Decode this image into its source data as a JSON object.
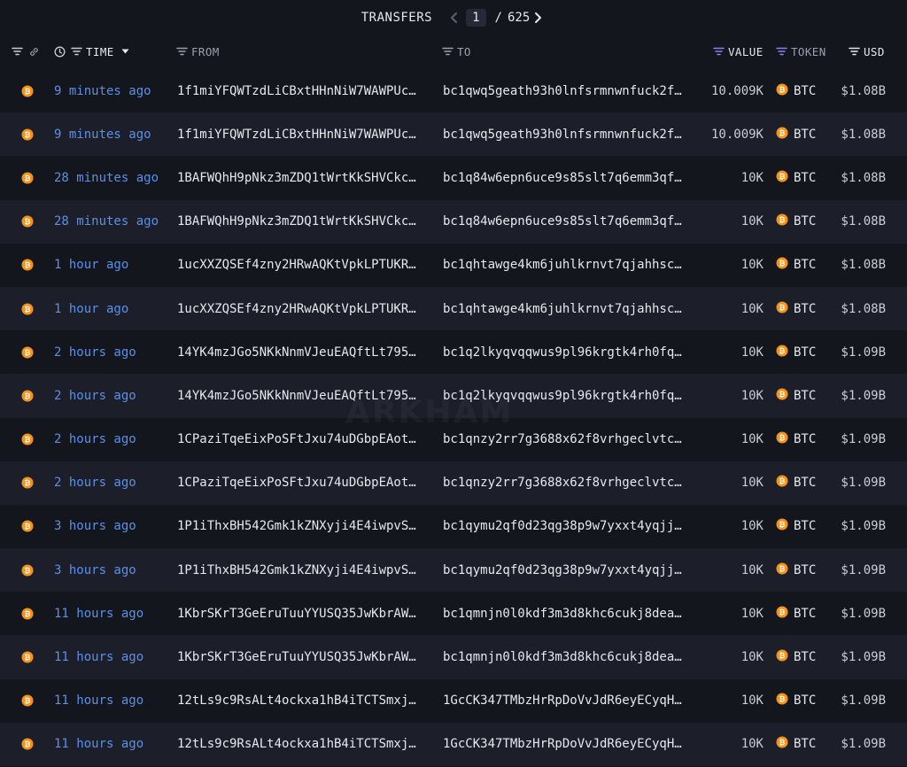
{
  "header": {
    "title": "TRANSFERS",
    "current_page": "1",
    "separator": "/",
    "total_pages": "625"
  },
  "columns": {
    "time": "TIME",
    "from": "FROM",
    "to": "TO",
    "value": "VALUE",
    "token": "TOKEN",
    "usd": "USD"
  },
  "watermark": "ARKHAM",
  "colors": {
    "background": "#14161e",
    "row_alt": "#1c1f2a",
    "time_link": "#5c8fe6",
    "btc": "#f7931a",
    "active_filter": "#8f7df2"
  },
  "rows": [
    {
      "time": "9 minutes ago",
      "from": "1f1miYFQWTzdLiCBxtHHnNiW7WAWPUc…",
      "to": "bc1qwq5geath93h0lnfsrmnwnfuck2f…",
      "value": "10.009K",
      "token": "BTC",
      "usd": "$1.08B"
    },
    {
      "time": "9 minutes ago",
      "from": "1f1miYFQWTzdLiCBxtHHnNiW7WAWPUc…",
      "to": "bc1qwq5geath93h0lnfsrmnwnfuck2f…",
      "value": "10.009K",
      "token": "BTC",
      "usd": "$1.08B"
    },
    {
      "time": "28 minutes ago",
      "from": "1BAFWQhH9pNkz3mZDQ1tWrtKkSHVCkc…",
      "to": "bc1q84w6epn6uce9s85slt7q6emm3qf…",
      "value": "10K",
      "token": "BTC",
      "usd": "$1.08B"
    },
    {
      "time": "28 minutes ago",
      "from": "1BAFWQhH9pNkz3mZDQ1tWrtKkSHVCkc…",
      "to": "bc1q84w6epn6uce9s85slt7q6emm3qf…",
      "value": "10K",
      "token": "BTC",
      "usd": "$1.08B"
    },
    {
      "time": "1 hour ago",
      "from": "1ucXXZQSEf4zny2HRwAQKtVpkLPTUKR…",
      "to": "bc1qhtawge4km6juhlkrnvt7qjahhsc…",
      "value": "10K",
      "token": "BTC",
      "usd": "$1.08B"
    },
    {
      "time": "1 hour ago",
      "from": "1ucXXZQSEf4zny2HRwAQKtVpkLPTUKR…",
      "to": "bc1qhtawge4km6juhlkrnvt7qjahhsc…",
      "value": "10K",
      "token": "BTC",
      "usd": "$1.08B"
    },
    {
      "time": "2 hours ago",
      "from": "14YK4mzJGo5NKkNnmVJeuEAQftLt795…",
      "to": "bc1q2lkyqvqqwus9pl96krgtk4rh0fq…",
      "value": "10K",
      "token": "BTC",
      "usd": "$1.09B"
    },
    {
      "time": "2 hours ago",
      "from": "14YK4mzJGo5NKkNnmVJeuEAQftLt795…",
      "to": "bc1q2lkyqvqqwus9pl96krgtk4rh0fq…",
      "value": "10K",
      "token": "BTC",
      "usd": "$1.09B"
    },
    {
      "time": "2 hours ago",
      "from": "1CPaziTqeEixPoSFtJxu74uDGbpEAot…",
      "to": "bc1qnzy2rr7g3688x62f8vrhgeclvtc…",
      "value": "10K",
      "token": "BTC",
      "usd": "$1.09B"
    },
    {
      "time": "2 hours ago",
      "from": "1CPaziTqeEixPoSFtJxu74uDGbpEAot…",
      "to": "bc1qnzy2rr7g3688x62f8vrhgeclvtc…",
      "value": "10K",
      "token": "BTC",
      "usd": "$1.09B"
    },
    {
      "time": "3 hours ago",
      "from": "1P1iThxBH542Gmk1kZNXyji4E4iwpvS…",
      "to": "bc1qymu2qf0d23qg38p9w7yxxt4yqjj…",
      "value": "10K",
      "token": "BTC",
      "usd": "$1.09B"
    },
    {
      "time": "3 hours ago",
      "from": "1P1iThxBH542Gmk1kZNXyji4E4iwpvS…",
      "to": "bc1qymu2qf0d23qg38p9w7yxxt4yqjj…",
      "value": "10K",
      "token": "BTC",
      "usd": "$1.09B"
    },
    {
      "time": "11 hours ago",
      "from": "1KbrSKrT3GeEruTuuYYUSQ35JwKbrAW…",
      "to": "bc1qmnjn0l0kdf3m3d8khc6cukj8dea…",
      "value": "10K",
      "token": "BTC",
      "usd": "$1.09B"
    },
    {
      "time": "11 hours ago",
      "from": "1KbrSKrT3GeEruTuuYYUSQ35JwKbrAW…",
      "to": "bc1qmnjn0l0kdf3m3d8khc6cukj8dea…",
      "value": "10K",
      "token": "BTC",
      "usd": "$1.09B"
    },
    {
      "time": "11 hours ago",
      "from": "12tLs9c9RsALt4ockxa1hB4iTCTSmxj…",
      "to": "1GcCK347TMbzHrRpDoVvJdR6eyECyqH…",
      "value": "10K",
      "token": "BTC",
      "usd": "$1.09B"
    },
    {
      "time": "11 hours ago",
      "from": "12tLs9c9RsALt4ockxa1hB4iTCTSmxj…",
      "to": "1GcCK347TMbzHrRpDoVvJdR6eyECyqH…",
      "value": "10K",
      "token": "BTC",
      "usd": "$1.09B"
    }
  ]
}
